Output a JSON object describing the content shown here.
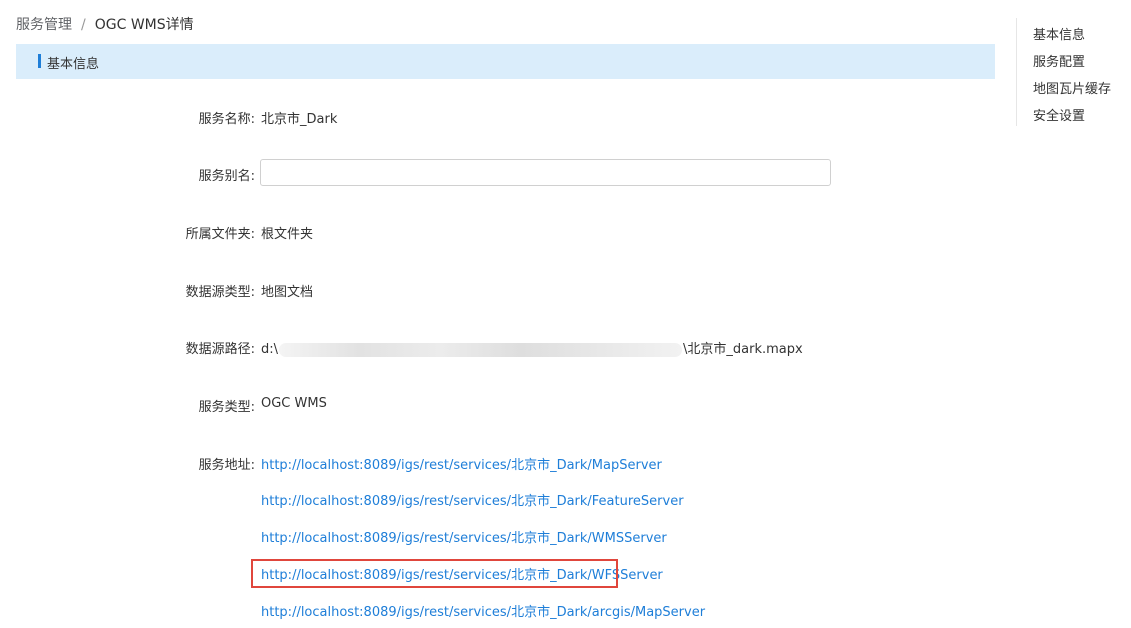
{
  "breadcrumb": {
    "root": "服务管理",
    "separator": "/",
    "current": "OGC WMS详情"
  },
  "section": {
    "title": "基本信息"
  },
  "fields": {
    "service_name": {
      "label": "服务名称:",
      "value": "北京市_Dark"
    },
    "service_alias": {
      "label": "服务别名:",
      "value": "",
      "placeholder": ""
    },
    "folder": {
      "label": "所属文件夹:",
      "value": "根文件夹"
    },
    "datasource_type": {
      "label": "数据源类型:",
      "value": "地图文档"
    },
    "datasource_path": {
      "label": "数据源路径:",
      "prefix": "d:\\",
      "suffix": "\\北京市_dark.mapx"
    },
    "service_type": {
      "label": "服务类型:",
      "value": "OGC WMS"
    },
    "service_address": {
      "label": "服务地址:",
      "links": [
        "http://localhost:8089/igs/rest/services/北京市_Dark/MapServer",
        "http://localhost:8089/igs/rest/services/北京市_Dark/FeatureServer",
        "http://localhost:8089/igs/rest/services/北京市_Dark/WMSServer",
        "http://localhost:8089/igs/rest/services/北京市_Dark/WFSServer",
        "http://localhost:8089/igs/rest/services/北京市_Dark/arcgis/MapServer"
      ]
    }
  },
  "side_nav": {
    "items": [
      "基本信息",
      "服务配置",
      "地图瓦片缓存",
      "安全设置"
    ]
  },
  "colors": {
    "accent": "#1e7ed8",
    "header_bg": "#daedfb",
    "highlight": "#e0463c"
  }
}
